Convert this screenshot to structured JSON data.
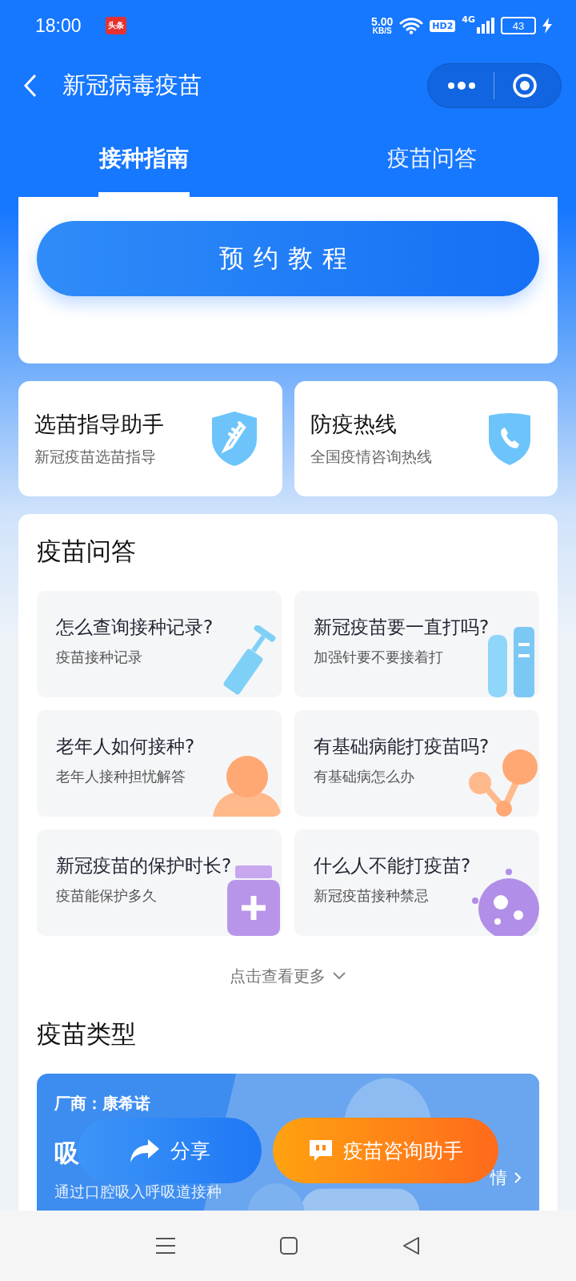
{
  "status_bar": {
    "time": "18:00",
    "app_badge": "头条",
    "speed": "5.00",
    "speed_unit": "KB/S",
    "hd": "HD2",
    "network": "4G",
    "battery": "43"
  },
  "header": {
    "title": "新冠病毒疫苗"
  },
  "tabs": [
    {
      "label": "接种指南",
      "selected": true
    },
    {
      "label": "疫苗问答",
      "selected": false
    }
  ],
  "primary_button": "预约教程",
  "shortcuts": [
    {
      "title": "选苗指导助手",
      "subtitle": "新冠疫苗选苗指导"
    },
    {
      "title": "防疫热线",
      "subtitle": "全国疫情咨询热线"
    }
  ],
  "qa": {
    "title": "疫苗问答",
    "items": [
      {
        "question": "怎么查询接种记录?",
        "hint": "疫苗接种记录"
      },
      {
        "question": "新冠疫苗要一直打吗?",
        "hint": "加强针要不要接着打"
      },
      {
        "question": "老年人如何接种?",
        "hint": "老年人接种担忧解答"
      },
      {
        "question": "有基础病能打疫苗吗?",
        "hint": "有基础病怎么办"
      },
      {
        "question": "新冠疫苗的保护时长?",
        "hint": "疫苗能保护多久"
      },
      {
        "question": "什么人不能打疫苗?",
        "hint": "新冠疫苗接种禁忌"
      }
    ],
    "more": "点击查看更多"
  },
  "vaccine_types": {
    "title": "疫苗类型",
    "card": {
      "maker": "厂商：康希诺",
      "name": "吸",
      "subtitle": "通过口腔吸入呼吸道接种",
      "details": "情"
    }
  },
  "floating": {
    "share": "分享",
    "assistant": "疫苗咨询助手"
  }
}
